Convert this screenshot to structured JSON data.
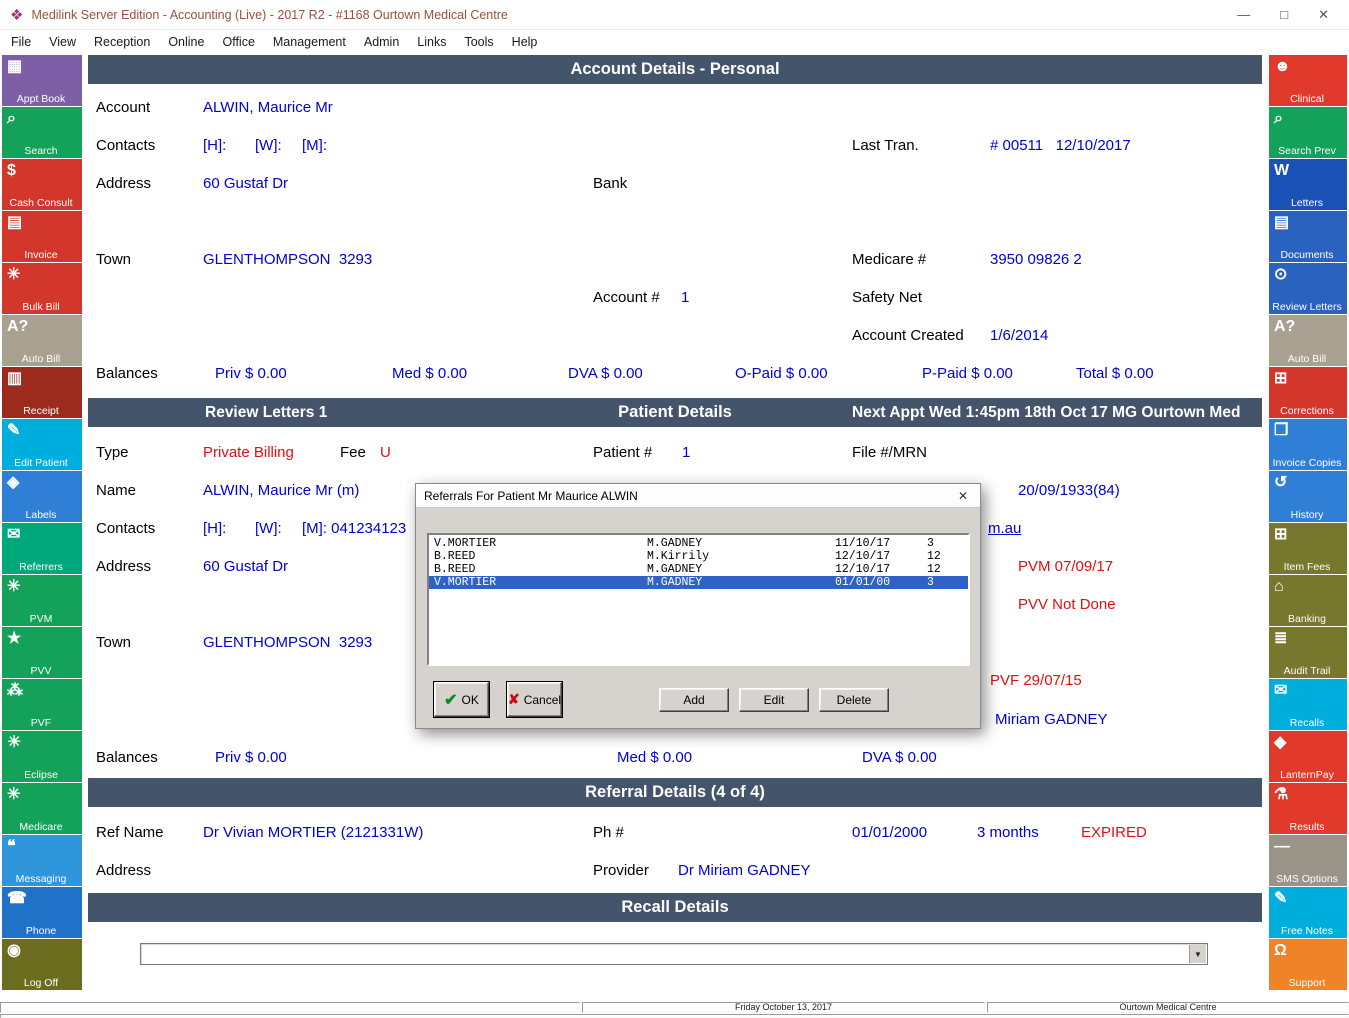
{
  "window": {
    "title": "Medilink Server Edition - Accounting (Live) - 2017 R2 - #1168 Ourtown Medical Centre"
  },
  "icons": {
    "logo": "❖",
    "minimize": "—",
    "maximize": "□",
    "close": "✕",
    "dialog_close": "✕",
    "ok_check": "✔",
    "cancel_x": "✘",
    "combo_arrow": "▼"
  },
  "colors": {
    "header_bar": "#44546a",
    "link_blue": "#0000d8",
    "alert_red": "#e01010",
    "selection_blue": "#2e62c6"
  },
  "menu": [
    "File",
    "View",
    "Reception",
    "Online",
    "Office",
    "Management",
    "Admin",
    "Links",
    "Tools",
    "Help"
  ],
  "left_sidebar": [
    {
      "label": "Appt Book",
      "icon": "appt-book-icon",
      "color": "#7d5fa8"
    },
    {
      "label": "Search",
      "icon": "search-icon",
      "color": "#14a15a"
    },
    {
      "label": "Cash Consult",
      "icon": "cash-consult-icon",
      "color": "#d3362b"
    },
    {
      "label": "Invoice",
      "icon": "invoice-icon",
      "color": "#d3362b"
    },
    {
      "label": "Bulk Bill",
      "icon": "bulk-bill-icon",
      "color": "#d3362b"
    },
    {
      "label": "Auto Bill",
      "icon": "auto-bill-icon",
      "color": "#a8a191"
    },
    {
      "label": "Receipt",
      "icon": "receipt-icon",
      "color": "#9c2b1e"
    },
    {
      "label": "Edit Patient",
      "icon": "edit-patient-icon",
      "color": "#00aede"
    },
    {
      "label": "Labels",
      "icon": "labels-icon",
      "color": "#2f7fd6"
    },
    {
      "label": "Referrers",
      "icon": "referrers-icon",
      "color": "#00a87c"
    },
    {
      "label": "PVM",
      "icon": "pvm-icon",
      "color": "#14a15a"
    },
    {
      "label": "PVV",
      "icon": "pvv-icon",
      "color": "#14a15a"
    },
    {
      "label": "PVF",
      "icon": "pvf-icon",
      "color": "#14a15a"
    },
    {
      "label": "Eclipse",
      "icon": "eclipse-icon",
      "color": "#14a15a"
    },
    {
      "label": "Medicare",
      "icon": "medicare-icon",
      "color": "#14a15a"
    },
    {
      "label": "Messaging",
      "icon": "messaging-icon",
      "color": "#2f96dc"
    },
    {
      "label": "Phone",
      "icon": "phone-icon",
      "color": "#2072c8"
    },
    {
      "label": "Log Off",
      "icon": "log-off-icon",
      "color": "#6c6c1e"
    }
  ],
  "right_sidebar": [
    {
      "label": "Clinical",
      "icon": "clinical-icon",
      "color": "#e13a2c"
    },
    {
      "label": "Search Prev",
      "icon": "search-prev-icon",
      "color": "#14a15a"
    },
    {
      "label": "Letters",
      "icon": "letters-icon",
      "color": "#1a52b8"
    },
    {
      "label": "Documents",
      "icon": "documents-icon",
      "color": "#2a62c0"
    },
    {
      "label": "Review Letters",
      "icon": "review-letters-icon",
      "color": "#2a62c0"
    },
    {
      "label": "Auto Bill",
      "icon": "auto-bill-icon",
      "color": "#a8a191"
    },
    {
      "label": "Corrections",
      "icon": "corrections-icon",
      "color": "#d3362b"
    },
    {
      "label": "Invoice Copies",
      "icon": "invoice-copies-icon",
      "color": "#2f7fd6"
    },
    {
      "label": "History",
      "icon": "history-icon",
      "color": "#2f7fd6"
    },
    {
      "label": "Item Fees",
      "icon": "item-fees-icon",
      "color": "#77772e"
    },
    {
      "label": "Banking",
      "icon": "banking-icon",
      "color": "#77772e"
    },
    {
      "label": "Audit Trail",
      "icon": "audit-trail-icon",
      "color": "#77772e"
    },
    {
      "label": "Recalls",
      "icon": "recalls-icon",
      "color": "#00aede"
    },
    {
      "label": "LanternPay",
      "icon": "lanternpay-icon",
      "color": "#e13a2c"
    },
    {
      "label": "Results",
      "icon": "results-icon",
      "color": "#e13a2c"
    },
    {
      "label": "SMS Options",
      "icon": "sms-options-icon",
      "color": "#9a9388"
    },
    {
      "label": "Free Notes",
      "icon": "free-notes-icon",
      "color": "#00aede"
    },
    {
      "label": "Support",
      "icon": "support-icon",
      "color": "#f08228"
    }
  ],
  "account": {
    "header": "Account Details - Personal",
    "account_label": "Account",
    "account_value": "ALWIN, Maurice Mr",
    "contacts_label": "Contacts",
    "contacts_h": "[H]:",
    "contacts_w": "[W]:",
    "contacts_m": "[M]:",
    "last_tran_label": "Last Tran.",
    "last_tran_value": "# 00511   12/10/2017",
    "address_label": "Address",
    "address_value": "60 Gustaf Dr",
    "bank_label": "Bank",
    "town_label": "Town",
    "town_value": "GLENTHOMPSON  3293",
    "medicare_label": "Medicare #",
    "medicare_value": "3950 09826 2",
    "account_no_label": "Account #",
    "account_no_value": "1",
    "safety_net_label": "Safety Net",
    "created_label": "Account Created",
    "created_value": "1/6/2014",
    "balances_label": "Balances",
    "balances": [
      "Priv $ 0.00",
      "Med $ 0.00",
      "DVA $ 0.00",
      "O-Paid $ 0.00",
      "P-Paid $ 0.00",
      "Total $ 0.00"
    ]
  },
  "patient": {
    "bar_left": "Review Letters 1",
    "bar_center": "Patient Details",
    "bar_right": "Next Appt Wed 1:45pm 18th Oct 17 MG Ourtown Med",
    "type_label": "Type",
    "type_value": "Private Billing",
    "fee_label": "Fee",
    "fee_value": "U",
    "patient_no_label": "Patient #",
    "patient_no_value": "1",
    "mrn_label": "File #/MRN",
    "name_label": "Name",
    "name_value": "ALWIN, Maurice Mr (m)",
    "dob": "20/09/1933(84)",
    "contacts_label": "Contacts",
    "contacts_h": "[H]:",
    "contacts_w": "[W]:",
    "contacts_m": "[M]: 041234123",
    "email_fragment": "m.au",
    "address_label": "Address",
    "address_value": "60 Gustaf Dr",
    "pvm": "PVM 07/09/17",
    "pvv": "PVV Not Done",
    "town_label": "Town",
    "town_value": "GLENTHOMPSON  3293",
    "pvf": "PVF 29/07/15",
    "provider_name": "Miriam GADNEY",
    "balances_label": "Balances",
    "balances": [
      "Priv $ 0.00",
      "Med $ 0.00",
      "DVA $ 0.00"
    ]
  },
  "referral": {
    "header": "Referral Details (4 of 4)",
    "ref_name_label": "Ref Name",
    "ref_name_value": "Dr Vivian MORTIER (2121331W)",
    "ph_label": "Ph #",
    "date": "01/01/2000",
    "duration": "3 months",
    "status": "EXPIRED",
    "address_label": "Address",
    "provider_label": "Provider",
    "provider_value": "Dr Miriam GADNEY"
  },
  "recall": {
    "header": "Recall Details"
  },
  "dialog": {
    "title": "Referrals For Patient Mr Maurice ALWIN",
    "rows": [
      {
        "referrer": "V.MORTIER",
        "provider": "M.GADNEY",
        "date": "11/10/17",
        "months": "3",
        "selected": false
      },
      {
        "referrer": "B.REED",
        "provider": "M.Kirrily",
        "date": "12/10/17",
        "months": "12",
        "selected": false
      },
      {
        "referrer": "B.REED",
        "provider": "M.GADNEY",
        "date": "12/10/17",
        "months": "12",
        "selected": false
      },
      {
        "referrer": "V.MORTIER",
        "provider": "M.GADNEY",
        "date": "01/01/00",
        "months": "3",
        "selected": true
      }
    ],
    "buttons": {
      "ok": "OK",
      "cancel": "Cancel",
      "add": "Add",
      "edit": "Edit",
      "delete": "Delete"
    }
  },
  "status": {
    "date": "Friday October 13, 2017",
    "centre": "Ourtown Medical Centre"
  }
}
